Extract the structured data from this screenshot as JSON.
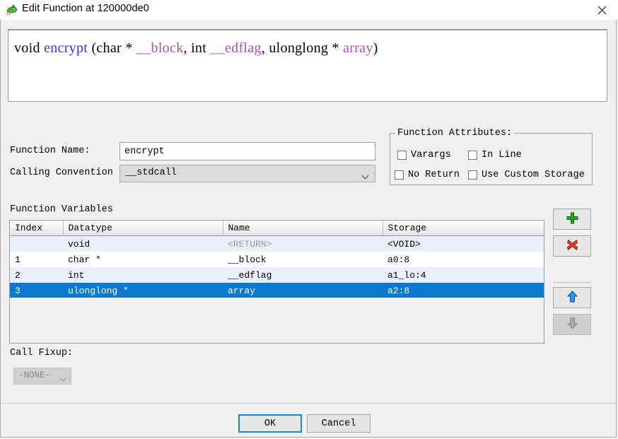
{
  "window": {
    "title": "Edit Function at 120000de0",
    "icon": "ghidra-dragon-icon",
    "close_label": "✕"
  },
  "signature": {
    "tokens": [
      {
        "text": "void ",
        "kind": "plain"
      },
      {
        "text": "encrypt",
        "kind": "fn"
      },
      {
        "text": " (char * ",
        "kind": "plain"
      },
      {
        "text": "__block",
        "kind": "param"
      },
      {
        "text": ", int ",
        "kind": "plain"
      },
      {
        "text": "__edflag",
        "kind": "param"
      },
      {
        "text": ", ulonglong * ",
        "kind": "plain"
      },
      {
        "text": "array",
        "kind": "param"
      },
      {
        "text": ")",
        "kind": "plain"
      }
    ],
    "plain_text": "void encrypt (char * __block, int __edflag, ulonglong * array)"
  },
  "form": {
    "function_name_label": "Function Name:",
    "function_name_value": "encrypt",
    "function_name_placeholder": "Function Name",
    "calling_convention_label": "Calling Convention",
    "calling_convention_value": "__stdcall"
  },
  "attributes": {
    "legend": "Function Attributes:",
    "items": [
      {
        "label": "Varargs",
        "checked": false
      },
      {
        "label": "In Line",
        "checked": false
      },
      {
        "label": "No Return",
        "checked": false
      },
      {
        "label": "Use Custom Storage",
        "checked": false
      }
    ]
  },
  "variables": {
    "label": "Function Variables",
    "columns": [
      "Index",
      "Datatype",
      "Name",
      "Storage"
    ],
    "rows": [
      {
        "index": "",
        "datatype": "void",
        "name": "<RETURN>",
        "storage": "<VOID>",
        "state": "alt",
        "name_dim": true
      },
      {
        "index": "1",
        "datatype": "char *",
        "name": "__block",
        "storage": "a0:8",
        "state": "plain",
        "name_dim": false
      },
      {
        "index": "2",
        "datatype": "int",
        "name": "__edflag",
        "storage": "a1_lo:4",
        "state": "alt",
        "name_dim": false
      },
      {
        "index": "3",
        "datatype": "ulonglong *",
        "name": "array",
        "storage": "a2:8",
        "state": "selected",
        "name_dim": false
      }
    ]
  },
  "side_buttons": [
    {
      "name": "add-variable-button",
      "icon": "plus-icon",
      "enabled": true
    },
    {
      "name": "delete-variable-button",
      "icon": "delete-x-icon",
      "enabled": true
    },
    {
      "name": "move-up-button",
      "icon": "arrow-up-icon",
      "enabled": true
    },
    {
      "name": "move-down-button",
      "icon": "arrow-down-icon",
      "enabled": false
    }
  ],
  "call_fixup": {
    "label": "Call Fixup:",
    "value": "-NONE-",
    "enabled": false
  },
  "footer": {
    "ok_label": "OK",
    "cancel_label": "Cancel"
  },
  "colors": {
    "selection": "#0c79d0",
    "alt_row": "#eaf0fa",
    "focus_border": "#1c84d8",
    "token_function": "#3434f0",
    "token_param": "#b050b0",
    "dialog_background": "#f0f0f0"
  }
}
